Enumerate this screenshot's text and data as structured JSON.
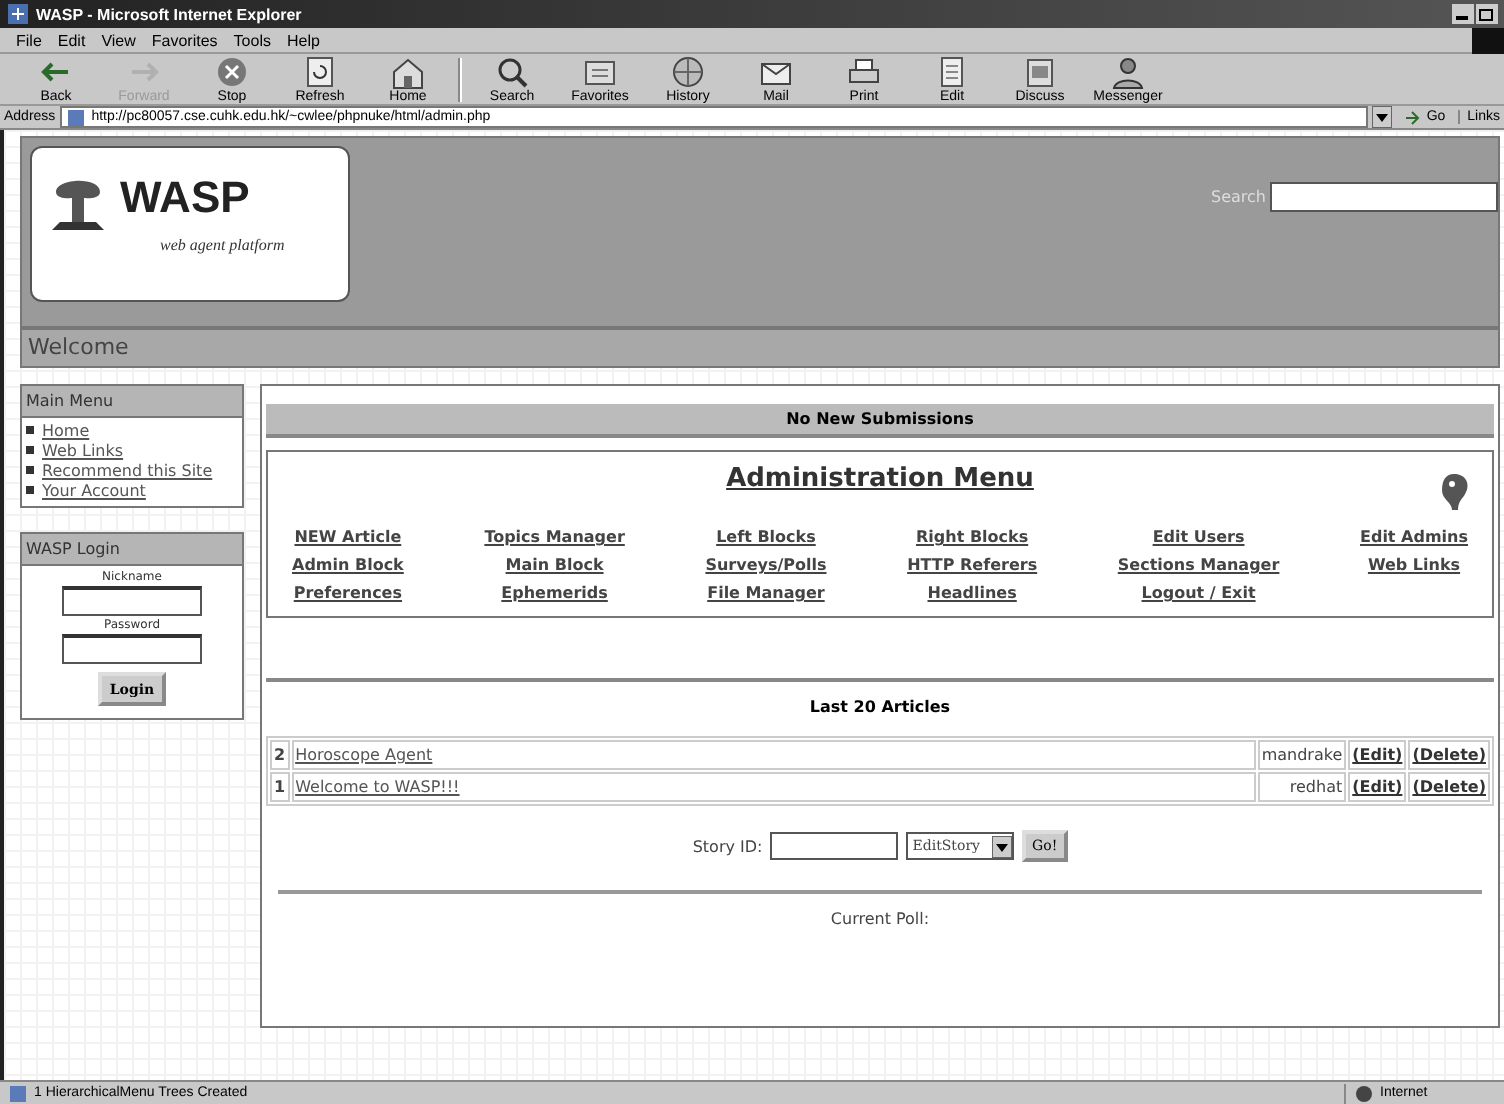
{
  "window": {
    "title": "WASP - Microsoft Internet Explorer"
  },
  "menu_bar": [
    "File",
    "Edit",
    "View",
    "Favorites",
    "Tools",
    "Help"
  ],
  "toolbar": [
    {
      "label": "Back",
      "kind": "back",
      "disabled": false
    },
    {
      "label": "Forward",
      "kind": "forward",
      "disabled": true
    },
    {
      "label": "Stop",
      "kind": "stop",
      "disabled": false
    },
    {
      "label": "Refresh",
      "kind": "refresh",
      "disabled": false
    },
    {
      "label": "Home",
      "kind": "home",
      "disabled": false
    },
    {
      "label": "Search",
      "kind": "search",
      "disabled": false
    },
    {
      "label": "Favorites",
      "kind": "favorites",
      "disabled": false
    },
    {
      "label": "History",
      "kind": "history",
      "disabled": false
    },
    {
      "label": "Mail",
      "kind": "mail",
      "disabled": false
    },
    {
      "label": "Print",
      "kind": "print",
      "disabled": false
    },
    {
      "label": "Edit",
      "kind": "edit",
      "disabled": false
    },
    {
      "label": "Discuss",
      "kind": "discuss",
      "disabled": false
    },
    {
      "label": "Messenger",
      "kind": "messenger",
      "disabled": false
    }
  ],
  "address_bar": {
    "label": "Address",
    "url": "http://pc80057.cse.cuhk.edu.hk/~cwlee/phpnuke/html/admin.php",
    "go": "Go",
    "links": "Links"
  },
  "page": {
    "logo": {
      "title": "WASP",
      "subtitle": "web agent platform"
    },
    "search_label": "Search",
    "welcome": "Welcome",
    "main_menu": {
      "title": "Main Menu",
      "items": [
        "Home",
        "Web Links",
        "Recommend this Site",
        "Your Account"
      ]
    },
    "login": {
      "title": "WASP Login",
      "nickname_label": "Nickname",
      "password_label": "Password",
      "button": "Login"
    },
    "submissions": "No New Submissions",
    "admin_menu": {
      "title": "Administration Menu",
      "links": [
        [
          "NEW Article",
          "Topics Manager",
          "Left Blocks",
          "Right Blocks",
          "Edit Users",
          "Edit Admins"
        ],
        [
          "Admin Block",
          "Main Block",
          "Surveys/Polls",
          "HTTP Referers",
          "Sections Manager",
          "Web Links"
        ],
        [
          "Preferences",
          "Ephemerids",
          "File Manager",
          "Headlines",
          "Logout / Exit"
        ]
      ]
    },
    "articles": {
      "title": "Last 20 Articles",
      "rows": [
        {
          "id": "2",
          "title": "Horoscope Agent",
          "author": "mandrake",
          "edit": "(Edit)",
          "delete": "(Delete)"
        },
        {
          "id": "1",
          "title": "Welcome to WASP!!!",
          "author": "redhat",
          "edit": "(Edit)",
          "delete": "(Delete)"
        }
      ]
    },
    "story": {
      "label": "Story ID:",
      "action": "EditStory",
      "button": "Go!"
    },
    "poll": "Current Poll:"
  },
  "status_bar": {
    "text": "1 HierarchicalMenu Trees Created",
    "zone": "Internet"
  }
}
